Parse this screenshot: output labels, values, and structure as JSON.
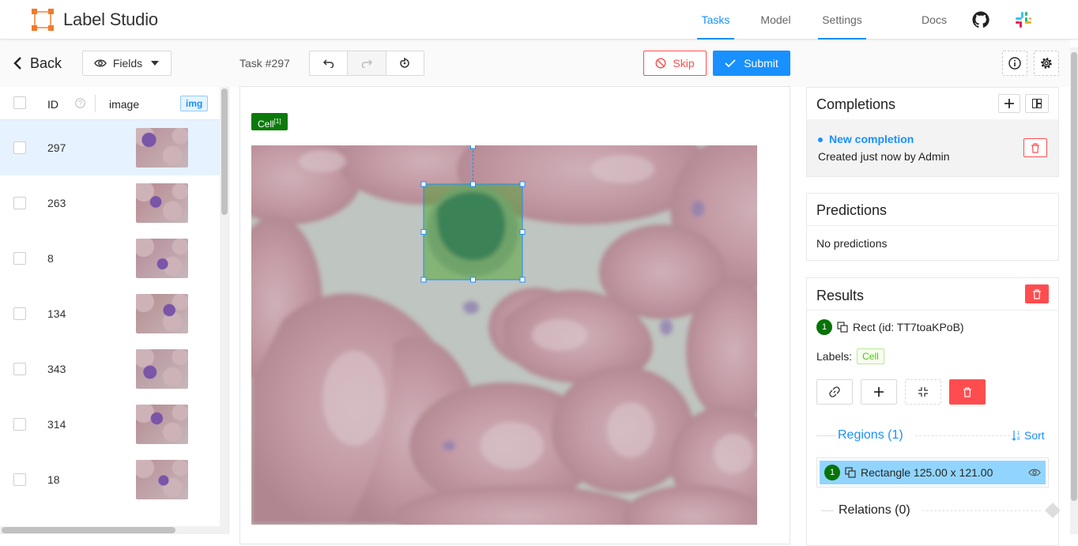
{
  "app": {
    "name": "Label Studio",
    "nav": {
      "tasks": "Tasks",
      "model": "Model",
      "settings": "Settings",
      "docs": "Docs"
    }
  },
  "toolbar": {
    "back": "Back",
    "fields": "Fields",
    "task": "Task #297",
    "skip": "Skip",
    "submit": "Submit"
  },
  "table": {
    "headers": {
      "id": "ID",
      "image": "image",
      "img_badge": "img"
    },
    "rows": [
      {
        "id": "297",
        "selected": true
      },
      {
        "id": "263",
        "selected": false
      },
      {
        "id": "8",
        "selected": false
      },
      {
        "id": "134",
        "selected": false
      },
      {
        "id": "343",
        "selected": false
      },
      {
        "id": "314",
        "selected": false
      },
      {
        "id": "18",
        "selected": false
      }
    ]
  },
  "canvas": {
    "label": "Cell",
    "label_sup": "[1]"
  },
  "completions": {
    "title": "Completions",
    "item_title": "New completion",
    "item_sub": "Created just now by Admin"
  },
  "predictions": {
    "title": "Predictions",
    "empty": "No predictions"
  },
  "results": {
    "title": "Results",
    "num": "1",
    "rect": "Rect (id: TT7toaKPoB)",
    "labels_caption": "Labels:",
    "label": "Cell",
    "regions": "Regions (1)",
    "sort": "Sort",
    "region_num": "1",
    "region_item": "Rectangle 125.00 x 121.00",
    "relations": "Relations (0)"
  },
  "colors": {
    "accent": "#1890ff",
    "label_green": "#0b7a0b",
    "danger": "#ff4d4f"
  }
}
